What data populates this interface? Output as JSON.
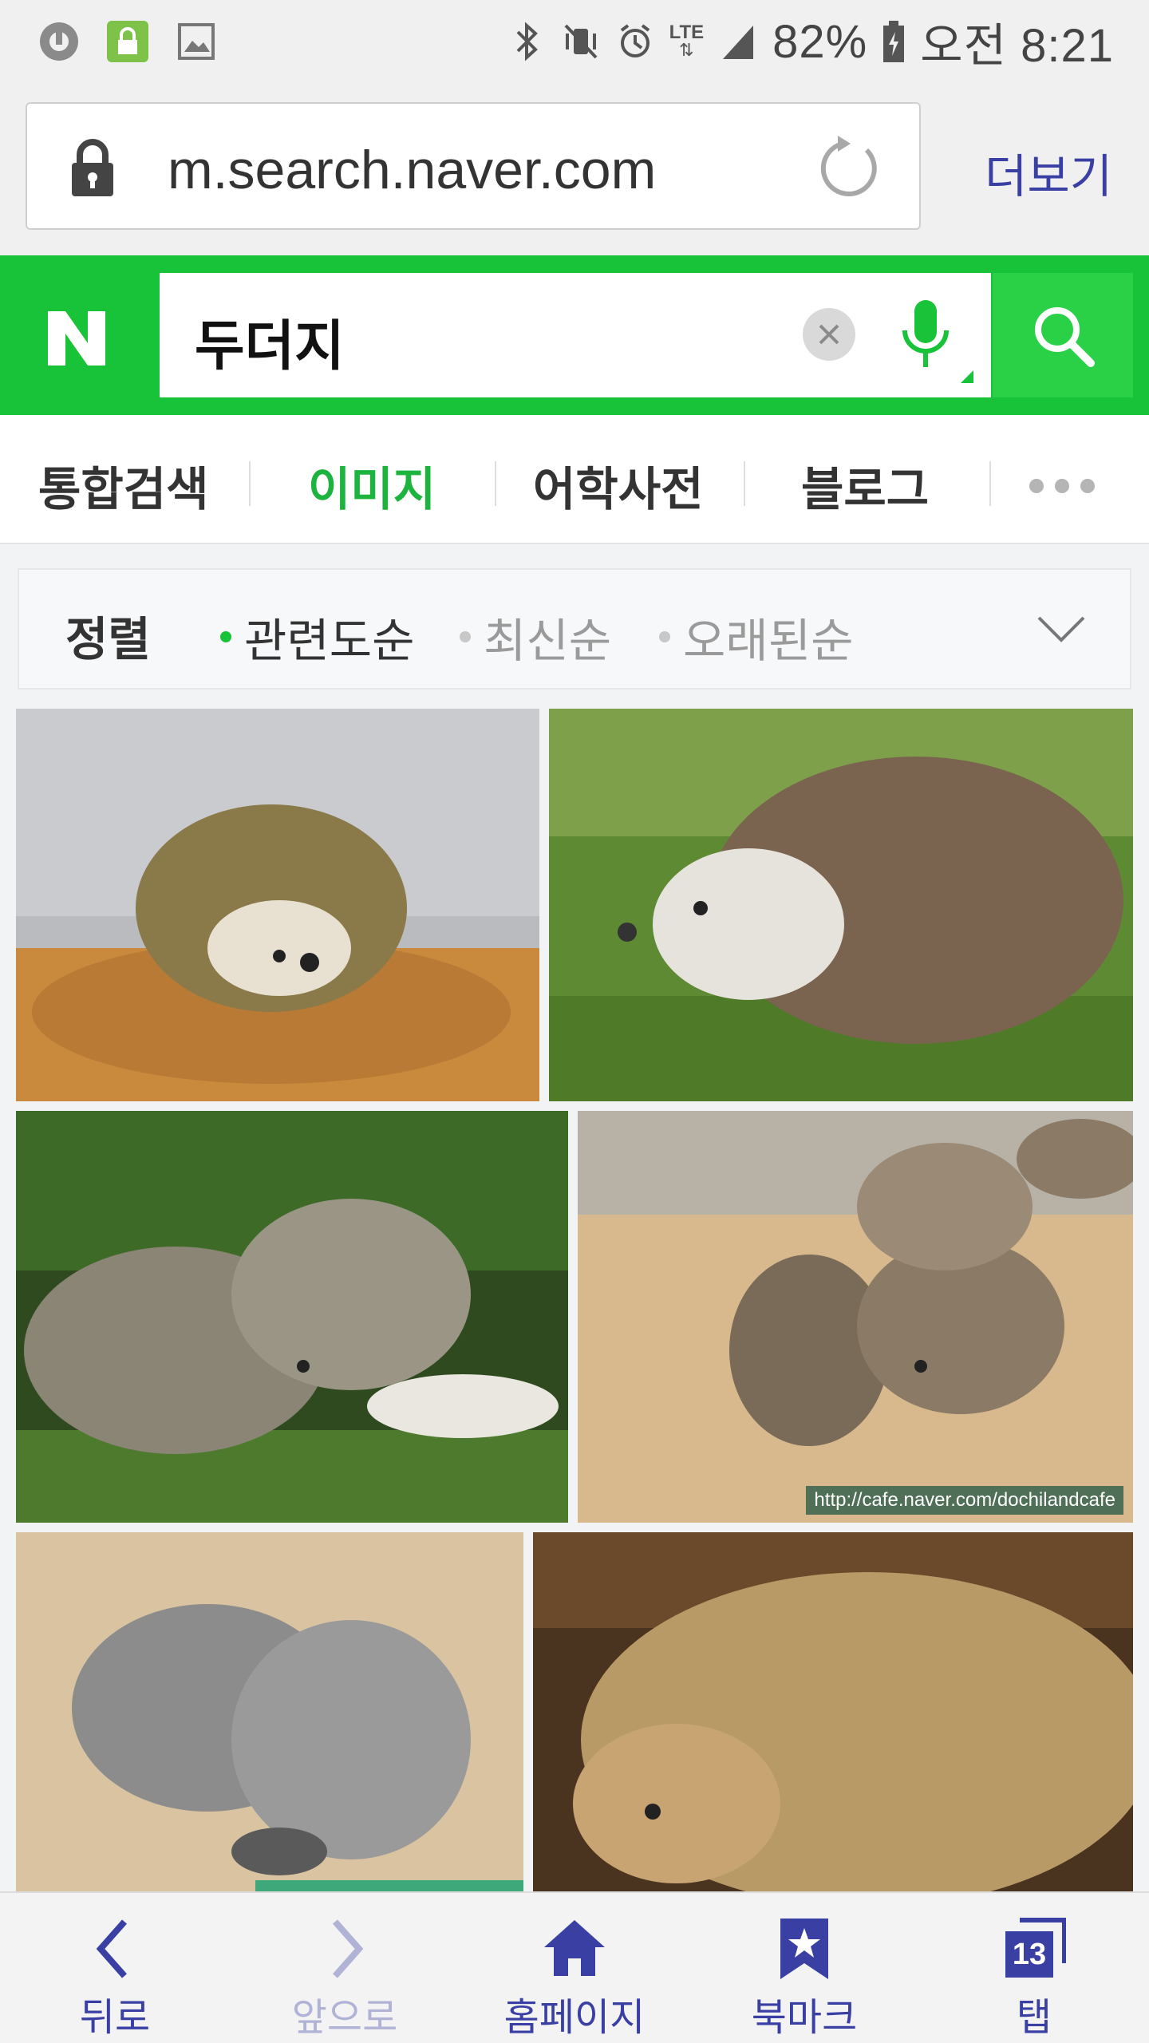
{
  "status_bar": {
    "battery": "82%",
    "time": "오전 8:21",
    "network": "LTE"
  },
  "browser": {
    "url": "m.search.naver.com",
    "more_label": "더보기"
  },
  "search": {
    "logo": "N",
    "query": "두더지"
  },
  "tabs": [
    {
      "label": "통합검색"
    },
    {
      "label": "이미지"
    },
    {
      "label": "어학사전"
    },
    {
      "label": "블로그"
    }
  ],
  "sort": {
    "label": "정렬",
    "options": [
      {
        "label": "관련도순"
      },
      {
        "label": "최신순"
      },
      {
        "label": "오래된순"
      }
    ]
  },
  "images": [
    {
      "caption": ""
    },
    {
      "caption": ""
    },
    {
      "caption": ""
    },
    {
      "caption": "http://cafe.naver.com/dochilandcafe"
    },
    {
      "caption": ""
    },
    {
      "caption": ""
    }
  ],
  "bottom_nav": {
    "back": "뒤로",
    "forward": "앞으로",
    "home": "홈페이지",
    "bookmark": "북마크",
    "tabs": "탭",
    "tab_count": "13"
  },
  "colors": {
    "naver_green": "#19c339",
    "active_tab": "#1db33f",
    "nav_blue": "#3a3fa4"
  }
}
